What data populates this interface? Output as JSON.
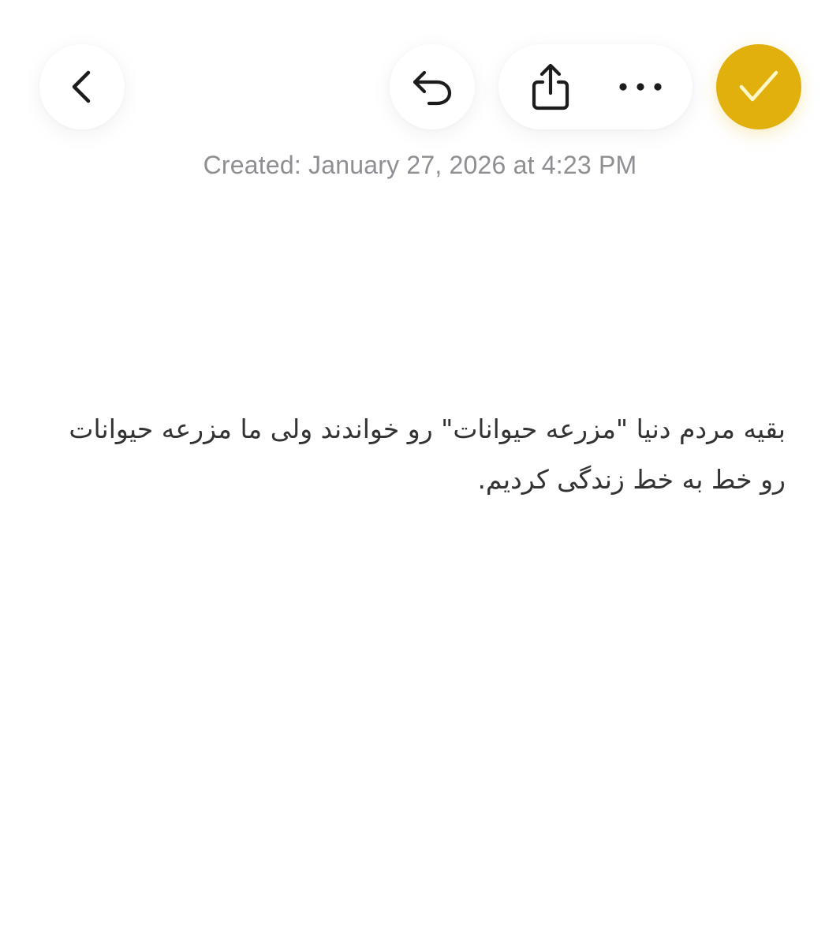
{
  "toolbar": {
    "back": {
      "icon": "chevron-left-icon"
    },
    "undo": {
      "icon": "undo-arrow-icon"
    },
    "share": {
      "icon": "share-icon"
    },
    "more": {
      "icon": "ellipsis-icon"
    },
    "done": {
      "icon": "checkmark-icon",
      "color": "#e2b00c"
    }
  },
  "note": {
    "created_label": "Created: January 27, 2026 at 4:23 PM",
    "body": "بقیه مردم دنیا \"مزرعه حیوانات\" رو خواندند ولی ما مزرعه حیوانات رو خط به خط زندگی کردیم."
  },
  "colors": {
    "accent": "#e2b00c",
    "meta_text": "#8e8e93",
    "body_text": "#333333",
    "icon": "#1c1c1e"
  }
}
